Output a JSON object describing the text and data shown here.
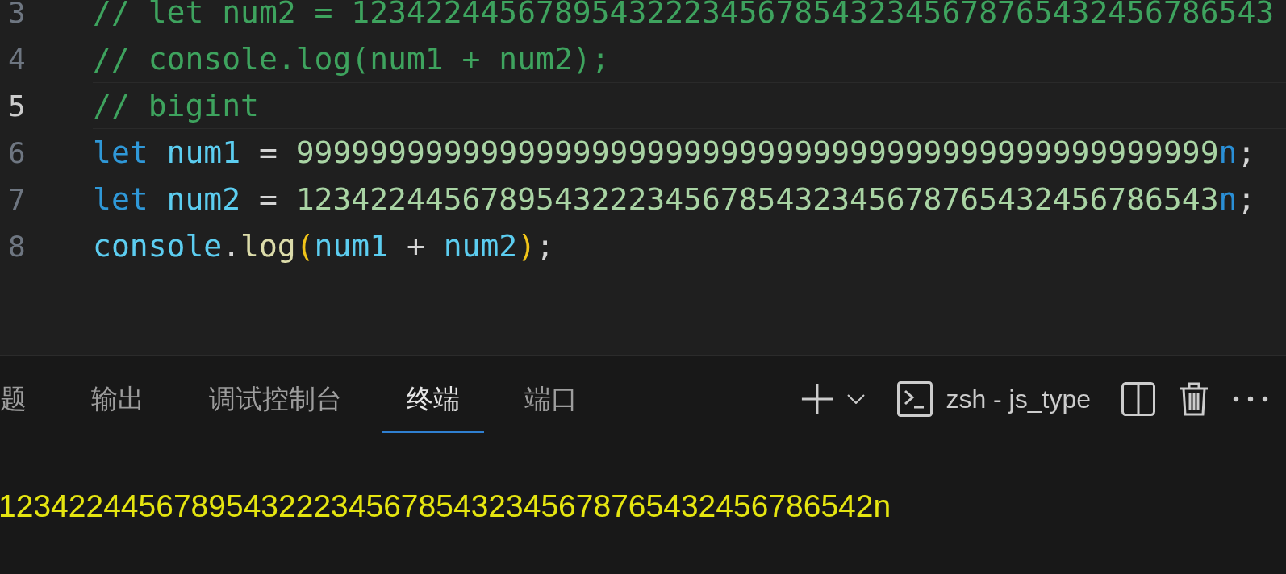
{
  "editor": {
    "lines": [
      {
        "number": "3",
        "current": false,
        "tokens": [
          {
            "kind": "comment",
            "text": "// let num2 = 12342244567895432223456785432345678765432456786543"
          }
        ]
      },
      {
        "number": "4",
        "current": false,
        "tokens": [
          {
            "kind": "comment",
            "text": "// console.log(num1 + num2);"
          }
        ]
      },
      {
        "number": "5",
        "current": true,
        "tokens": [
          {
            "kind": "comment",
            "text": "// bigint"
          }
        ]
      },
      {
        "number": "6",
        "current": false,
        "tokens": [
          {
            "kind": "keyword",
            "text": "let "
          },
          {
            "kind": "variable",
            "text": "num1"
          },
          {
            "kind": "plain",
            "text": " = "
          },
          {
            "kind": "number",
            "text": "99999999999999999999999999999999999999999999999999"
          },
          {
            "kind": "suffix",
            "text": "n"
          },
          {
            "kind": "plain",
            "text": ";"
          }
        ]
      },
      {
        "number": "7",
        "current": false,
        "tokens": [
          {
            "kind": "keyword",
            "text": "let "
          },
          {
            "kind": "variable",
            "text": "num2"
          },
          {
            "kind": "plain",
            "text": " = "
          },
          {
            "kind": "number",
            "text": "12342244567895432223456785432345678765432456786543"
          },
          {
            "kind": "suffix",
            "text": "n"
          },
          {
            "kind": "plain",
            "text": ";"
          }
        ]
      },
      {
        "number": "8",
        "current": false,
        "tokens": [
          {
            "kind": "object",
            "text": "console"
          },
          {
            "kind": "plain",
            "text": "."
          },
          {
            "kind": "function",
            "text": "log"
          },
          {
            "kind": "bracket",
            "text": "("
          },
          {
            "kind": "variable",
            "text": "num1"
          },
          {
            "kind": "plain",
            "text": " + "
          },
          {
            "kind": "variable",
            "text": "num2"
          },
          {
            "kind": "bracket",
            "text": ")"
          },
          {
            "kind": "plain",
            "text": ";"
          }
        ]
      }
    ]
  },
  "panel": {
    "tabs": [
      {
        "label": "题",
        "selected": false
      },
      {
        "label": "输出",
        "selected": false
      },
      {
        "label": "调试控制台",
        "selected": false
      },
      {
        "label": "终端",
        "selected": true
      },
      {
        "label": "端口",
        "selected": false
      }
    ],
    "terminal_name": "zsh - js_type",
    "output": [
      "12342244567895432223456785432345678765432456786542n"
    ]
  }
}
